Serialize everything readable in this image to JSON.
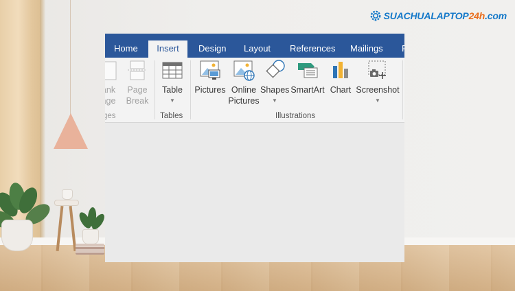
{
  "watermark": {
    "brand_part1": "SUACHUALAPTOP",
    "brand_part2": "24h",
    "brand_part3": ".com"
  },
  "tabs": [
    {
      "label": "Home"
    },
    {
      "label": "Insert",
      "active": true
    },
    {
      "label": "Design"
    },
    {
      "label": "Layout"
    },
    {
      "label": "References"
    },
    {
      "label": "Mailings"
    },
    {
      "label": "R"
    }
  ],
  "ribbon": {
    "pages_group": {
      "blank_page": {
        "line1": "ank",
        "line2": "age"
      },
      "page_break": {
        "line1": "Page",
        "line2": "Break"
      },
      "label": "ges"
    },
    "tables_group": {
      "table": {
        "label": "Table"
      },
      "label": "Tables"
    },
    "illustrations_group": {
      "pictures": {
        "label": "Pictures"
      },
      "online_pictures": {
        "line1": "Online",
        "line2": "Pictures"
      },
      "shapes": {
        "label": "Shapes"
      },
      "smartart": {
        "label": "SmartArt"
      },
      "chart": {
        "label": "Chart"
      },
      "screenshot": {
        "label": "Screenshot"
      },
      "label": "Illustrations"
    }
  },
  "colors": {
    "ribbon_blue": "#2b579a",
    "ribbon_bg": "#f3f3f3",
    "brand_blue": "#1579c9",
    "brand_orange": "#e96e1e"
  }
}
